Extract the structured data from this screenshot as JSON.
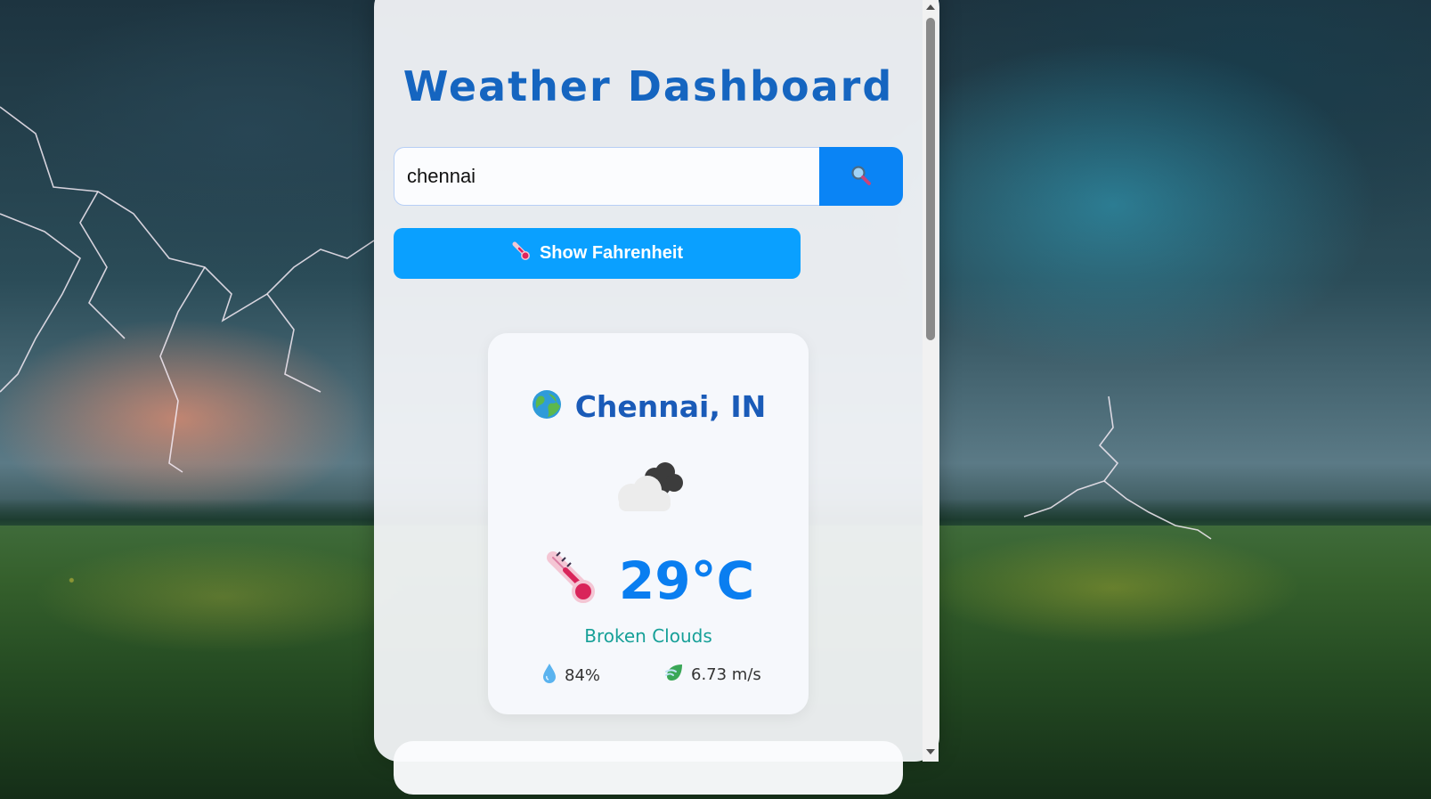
{
  "header": {
    "title": "Weather Dashboard"
  },
  "search": {
    "value": "chennai",
    "button_icon": "magnifier-icon"
  },
  "unit_toggle": {
    "label": "Show Fahrenheit",
    "icon": "thermometer-icon"
  },
  "weather": {
    "location_icon": "globe-icon",
    "location": "Chennai, IN",
    "condition_icon": "cloud-icon",
    "temperature": "29°C",
    "temperature_icon": "thermometer-icon",
    "condition": "Broken Clouds",
    "humidity": "84%",
    "humidity_icon": "droplet-icon",
    "wind": "6.73 m/s",
    "wind_icon": "leaf-wind-icon"
  },
  "colors": {
    "title": "#1565c0",
    "search_button": "#0a84f5",
    "toggle_button": "#0aa0ff",
    "temperature": "#0a7ef0",
    "condition": "#17a098"
  }
}
